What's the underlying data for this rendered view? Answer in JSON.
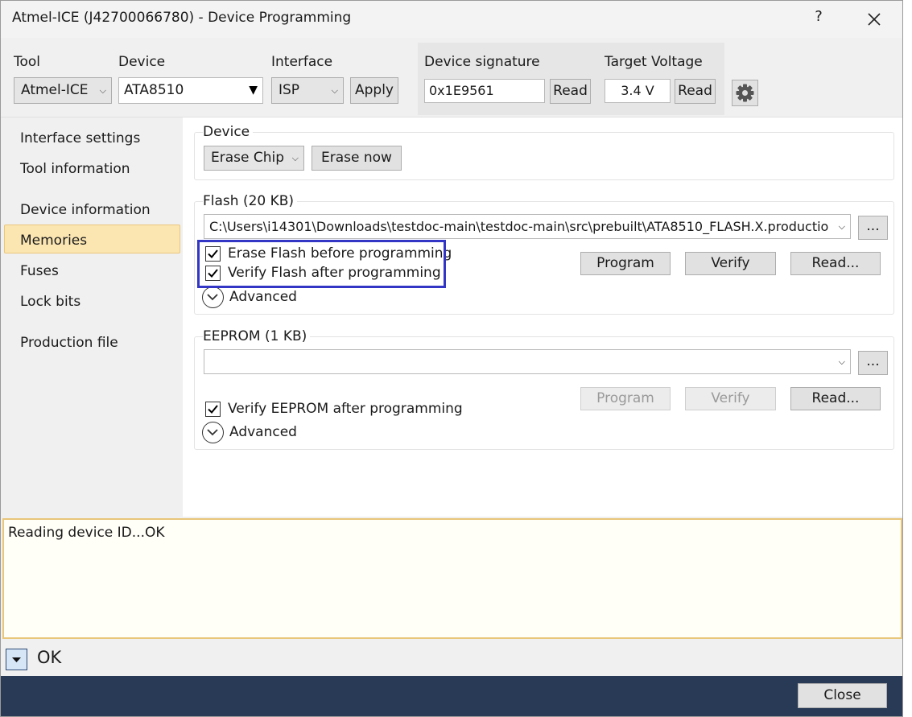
{
  "window": {
    "title": "Atmel-ICE (J42700066780) - Device Programming",
    "help_glyph": "?",
    "close_glyph": "✕"
  },
  "toolbar": {
    "tool_label": "Tool",
    "tool_value": "Atmel-ICE",
    "device_label": "Device",
    "device_value": "ATA8510",
    "interface_label": "Interface",
    "interface_value": "ISP",
    "apply_label": "Apply",
    "signature_label": "Device signature",
    "signature_value": "0x1E9561",
    "signature_read_label": "Read",
    "voltage_label": "Target Voltage",
    "voltage_value": "3.4 V",
    "voltage_read_label": "Read"
  },
  "sidebar": {
    "items": [
      {
        "label": "Interface settings",
        "selected": false
      },
      {
        "label": "Tool information",
        "selected": false
      },
      {
        "label": "Device information",
        "selected": false
      },
      {
        "label": "Memories",
        "selected": true
      },
      {
        "label": "Fuses",
        "selected": false
      },
      {
        "label": "Lock bits",
        "selected": false
      },
      {
        "label": "Production file",
        "selected": false
      }
    ]
  },
  "device_section": {
    "title": "Device",
    "erase_option": "Erase Chip",
    "erase_now_label": "Erase now"
  },
  "flash_section": {
    "title": "Flash (20 KB)",
    "file_path": "C:\\Users\\i14301\\Downloads\\testdoc-main\\testdoc-main\\src\\prebuilt\\ATA8510_FLASH.X.productio",
    "browse_label": "...",
    "erase_before_label": "Erase Flash before programming",
    "erase_before_checked": true,
    "verify_after_label": "Verify Flash after programming",
    "verify_after_checked": true,
    "program_label": "Program",
    "verify_label": "Verify",
    "read_label": "Read...",
    "advanced_label": "Advanced"
  },
  "eeprom_section": {
    "title": "EEPROM (1 KB)",
    "file_path": "",
    "browse_label": "...",
    "verify_after_label": "Verify EEPROM after programming",
    "verify_after_checked": true,
    "program_label": "Program",
    "verify_label": "Verify",
    "read_label": "Read...",
    "advanced_label": "Advanced"
  },
  "log": {
    "text": "Reading device ID...OK"
  },
  "status": {
    "text": "OK"
  },
  "footer": {
    "close_label": "Close"
  },
  "colors": {
    "selection_bg": "#fbe6b2",
    "highlight_box": "#3336c4",
    "footer_bg": "#283a55",
    "log_border": "#e8c67a"
  }
}
